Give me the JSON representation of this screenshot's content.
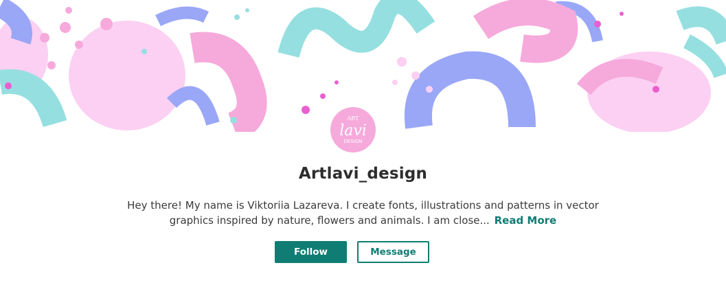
{
  "profile": {
    "name": "Artlavi_design",
    "bio_text": "Hey there! My name is Viktoriia Lazareva. I create fonts, illustrations and patterns in vector graphics inspired by nature, flowers and animals. I am close...",
    "read_more_label": "Read More",
    "avatar_logo_text": [
      "ART",
      "lavi",
      "DESIGN"
    ]
  },
  "actions": {
    "follow_label": "Follow",
    "message_label": "Message"
  },
  "colors": {
    "accent": "#0f7d73",
    "banner_pink": "#f6a9db",
    "banner_blue": "#9aa7f7",
    "banner_cyan": "#96dfe0",
    "banner_light_pink": "#fcd0f2"
  },
  "icons": {
    "banner": "abstract-brush-pattern",
    "avatar": "artlavi-logo"
  }
}
